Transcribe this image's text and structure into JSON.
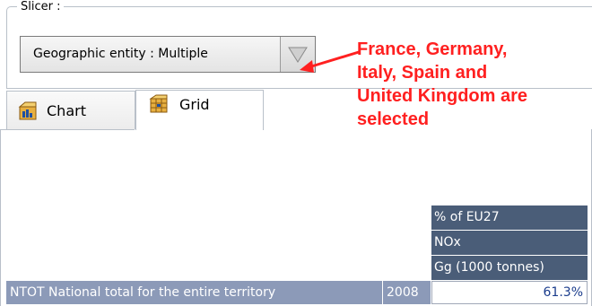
{
  "slicer": {
    "legend": "Slicer :",
    "selected_value": "Geographic entity : Multiple"
  },
  "tabs": [
    {
      "label": "Chart",
      "icon": "chart-icon",
      "active": false
    },
    {
      "label": "Grid",
      "icon": "grid-icon",
      "active": true
    }
  ],
  "annotation": {
    "lines": [
      "France, Germany,",
      "Italy, Spain and",
      "United Kingdom are",
      "selected"
    ],
    "color": "#ff2020"
  },
  "grid": {
    "column_headers": [
      "% of EU27",
      "NOx",
      "Gg (1000 tonnes)"
    ],
    "rows": [
      {
        "label": "NTOT National total for the entire territory",
        "year": "2008",
        "value": "61.3%"
      }
    ],
    "header_color": "#4a5d78",
    "row_header_color": "#8c9ab8"
  }
}
